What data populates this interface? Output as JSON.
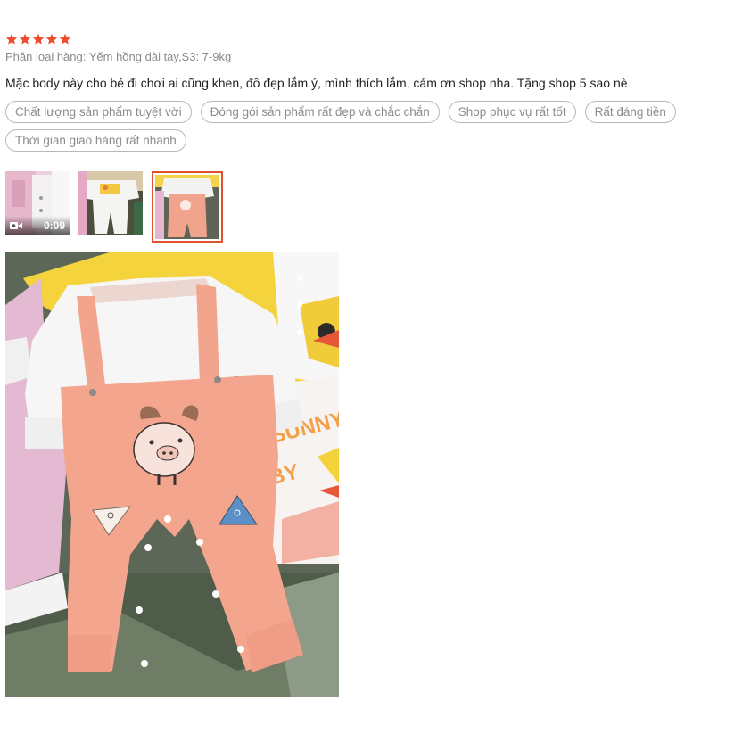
{
  "review": {
    "rating": 5,
    "star_color": "#ee4d2d",
    "variant": "Phân loại hàng: Yếm hồng dài tay,S3: 7-9kg",
    "comment": "Mặc body này cho bé đi chơi ai cũng khen, đồ đẹp lắm ý, mình thích lắm, cảm ơn shop nha. Tặng shop 5 sao nè",
    "tags": [
      "Chất lượng sản phẩm tuyệt vời",
      "Đóng gói sản phẩm rất đẹp và chắc chắn",
      "Shop phục vụ rất tốt",
      "Rất đáng tiền",
      "Thời gian giao hàng rất nhanh"
    ]
  },
  "media": {
    "video_duration": "0:09",
    "video_icon": "video-camera-icon",
    "thumbnails": [
      "video-thumbnail",
      "photo-thumbnail-white-romper",
      "photo-thumbnail-pink-overall"
    ],
    "selected_index": 2,
    "selected_border_color": "#e0532e"
  }
}
